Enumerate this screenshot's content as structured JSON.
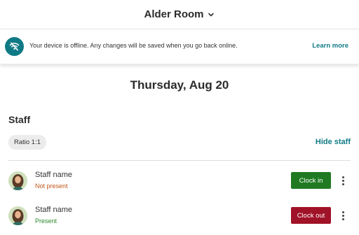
{
  "header": {
    "room_name": "Alder Room"
  },
  "offline_banner": {
    "message": "Your device is offline. Any changes will be saved when you go back online.",
    "learn_more": "Learn more",
    "icon": "wifi-off-icon",
    "icon_bg": "#0f7a86"
  },
  "date": "Thursday, Aug 20",
  "staff_section": {
    "title": "Staff",
    "ratio_label": "Ratio 1:1",
    "hide_label": "Hide staff",
    "members": [
      {
        "name": "Staff name",
        "status": "Not present",
        "action": "Clock in",
        "action_color": "#1f7a22",
        "status_color": "#c0561b"
      },
      {
        "name": "Staff name",
        "status": "Present",
        "action": "Clock out",
        "action_color": "#a01227",
        "status_color": "#2b8a2b"
      }
    ]
  },
  "colors": {
    "accent": "#0f7a86"
  }
}
